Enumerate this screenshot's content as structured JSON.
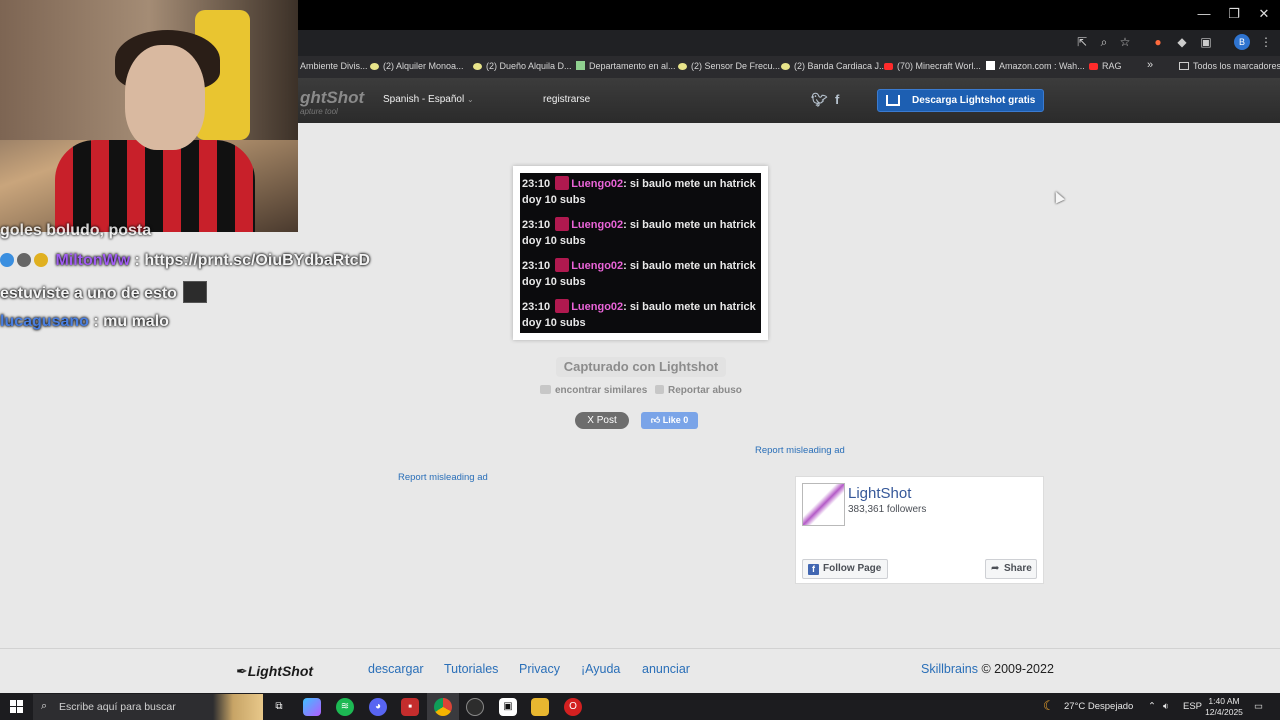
{
  "window": {
    "minimize_icon": "—",
    "restore_icon": "❐",
    "close_icon": "✕"
  },
  "toolbar_icons": [
    "install-icon",
    "zoom-icon",
    "star-icon",
    "extension-fox-icon",
    "extension-icon",
    "puzzle-icon",
    "profile-icon",
    "menu-icon"
  ],
  "profile_initial": "B",
  "bookmarks": [
    {
      "label": "Ambiente Divis...",
      "icon": "none"
    },
    {
      "label": "(2) Alquiler Monoa...",
      "icon": "dot"
    },
    {
      "label": "(2) Dueño Alquila D...",
      "icon": "dot"
    },
    {
      "label": "Departamento en al...",
      "icon": "photo"
    },
    {
      "label": "(2) Sensor De Frecu...",
      "icon": "dot"
    },
    {
      "label": "(2) Banda Cardiaca J...",
      "icon": "dot"
    },
    {
      "label": "(70) Minecraft Worl...",
      "icon": "youtube"
    },
    {
      "label": "Amazon.com : Wah...",
      "icon": "amazon"
    },
    {
      "label": "RAG",
      "icon": "youtube"
    }
  ],
  "bookmarks_more": "»",
  "bookmarks_all": "Todos los marcadores",
  "header": {
    "logo": "ghtShot",
    "sublogo": "apture tool",
    "language": "Spanish - Español",
    "register": "registrarse",
    "twitter_icon": "𝕥",
    "facebook_icon": "f",
    "download_button": "Descarga Lightshot gratis"
  },
  "screenshot": {
    "lines": [
      {
        "time": "23:10",
        "user": "Luengo02",
        "text": ": si baulo mete un hatrick doy 10 subs"
      },
      {
        "time": "23:10",
        "user": "Luengo02",
        "text": ": si baulo mete un hatrick doy 10 subs"
      },
      {
        "time": "23:10",
        "user": "Luengo02",
        "text": ": si baulo mete un hatrick doy 10 subs"
      },
      {
        "time": "23:10",
        "user": "Luengo02",
        "text": ": si baulo mete un hatrick doy 10 subs"
      }
    ]
  },
  "captured_label": "Capturado con Lightshot",
  "find_similar": "encontrar similares",
  "report_abuse": "Reportar abuso",
  "post_button": "X Post",
  "like_button": "Like 0",
  "report_ad_1": "Report misleading ad",
  "report_ad_2": "Report misleading ad",
  "fb": {
    "name": "LightShot",
    "followers": "383,361 followers",
    "follow_button": "Follow Page",
    "share_button": "Share"
  },
  "footer": {
    "logo": "LightShot",
    "links": [
      "descargar",
      "Tutoriales",
      "Privacy",
      "¡Ayuda",
      "anunciar"
    ],
    "brand": "Skillbrains",
    "copyright": " © 2009-2022"
  },
  "stream_chat": [
    {
      "name": "",
      "text": "goles boludo, posta"
    },
    {
      "name": "MiltonWw",
      "text": " : https://prnt.sc/OiuBYdbaRtcD"
    },
    {
      "name": "",
      "text": "estuviste a uno de esto"
    },
    {
      "name": "lucagusano",
      "text": " : mu malo"
    }
  ],
  "taskbar": {
    "search_placeholder": "Escribe aquí para buscar",
    "weather": "27°C  Despejado",
    "lang": "ESP",
    "time": "1:40 AM",
    "date": "12/4/2025"
  }
}
